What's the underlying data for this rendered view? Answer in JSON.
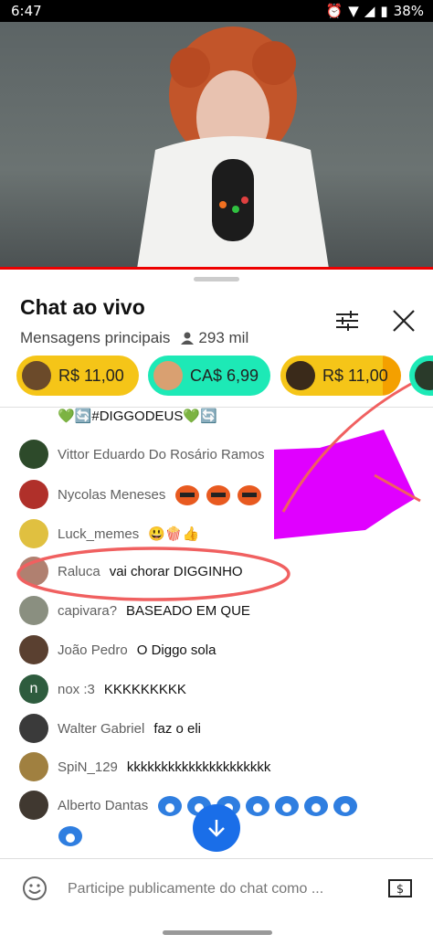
{
  "status": {
    "time": "6:47",
    "battery": "38%"
  },
  "colors": {
    "accent": "#1a6ee8",
    "super_chat_yellow": "#f5c518",
    "super_chat_teal": "#1de9b6",
    "progress": "#e00000"
  },
  "chat": {
    "title": "Chat ao vivo",
    "mode": "Mensagens principais",
    "viewers": "293 mil",
    "chips": [
      {
        "amount": "R$ 11,00"
      },
      {
        "amount": "CA$ 6,99"
      },
      {
        "amount": "R$ 11,00"
      }
    ],
    "partial_top_message": "💚🔄#DIGGODEUS💚🔄",
    "messages": [
      {
        "author": "Vittor Eduardo Do Rosário Ramos",
        "text": ""
      },
      {
        "author": "Nycolas Meneses",
        "text": ""
      },
      {
        "author": "Luck_memes",
        "text": "😃🍿👍"
      },
      {
        "author": "Raluca",
        "text": "vai chorar DIGGINHO"
      },
      {
        "author": "capivara?",
        "text": "BASEADO EM QUE"
      },
      {
        "author": "João Pedro",
        "text": "O Diggo sola"
      },
      {
        "author": "nox :3",
        "text": "KKKKKKKKK",
        "avatar_letter": "n"
      },
      {
        "author": "Walter Gabriel",
        "text": "faz o eli"
      },
      {
        "author": "SpiN_129",
        "text": "kkkkkkkkkkkkkkkkkkkkk"
      },
      {
        "author": "Alberto Dantas",
        "text": ""
      }
    ],
    "input_placeholder": "Participe publicamente do chat como ..."
  }
}
